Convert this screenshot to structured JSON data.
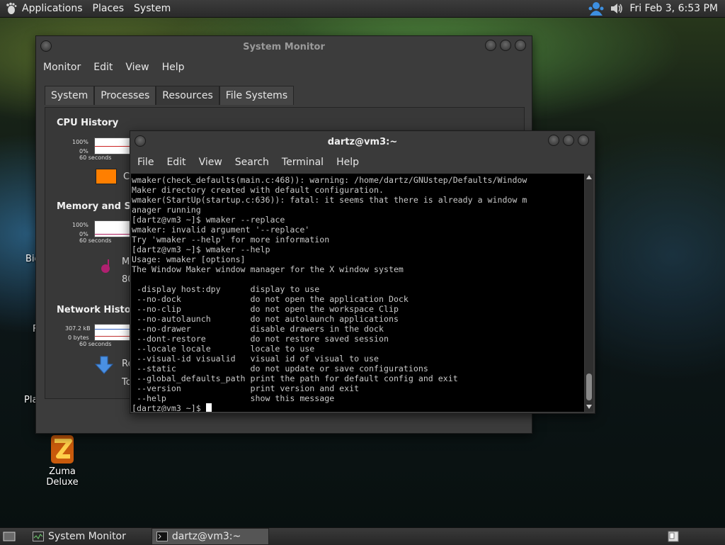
{
  "top_panel": {
    "menus": [
      "Applications",
      "Places",
      "System"
    ],
    "clock": "Fri Feb  3,  6:53 PM",
    "icons": [
      "gnome-foot-icon",
      "user-status-icon",
      "volume-icon"
    ]
  },
  "desktop": {
    "icons": [
      {
        "label": "Zuma Deluxe",
        "icon": "zuma-icon"
      }
    ],
    "clipped_labels": [
      "Big",
      "F",
      "Pla"
    ]
  },
  "system_monitor": {
    "title": "System Monitor",
    "menus": [
      "Monitor",
      "Edit",
      "View",
      "Help"
    ],
    "tabs": [
      "System",
      "Processes",
      "Resources",
      "File Systems"
    ],
    "active_tab": "Resources",
    "sections": {
      "cpu": {
        "title": "CPU History",
        "top": "100%",
        "bottom": "0%",
        "time": "60 seconds",
        "legend_letter": "C",
        "color": "#ff7f00"
      },
      "memory": {
        "title": "Memory and Swa",
        "top": "100%",
        "bottom": "0%",
        "time": "60 seconds",
        "legend_letter": "M",
        "value_fragment": "80"
      },
      "network": {
        "title": "Network History",
        "top": "307.2 kB",
        "bottom": "0 bytes",
        "time": "60 seconds",
        "recv_fragment": "Re",
        "total_fragment": "To"
      }
    }
  },
  "terminal": {
    "title": "dartz@vm3:~",
    "menus": [
      "File",
      "Edit",
      "View",
      "Search",
      "Terminal",
      "Help"
    ],
    "lines": [
      "wmaker(check_defaults(main.c:468)): warning: /home/dartz/GNUstep/Defaults/Window",
      "Maker directory created with default configuration.",
      "wmaker(StartUp(startup.c:636)): fatal: it seems that there is already a window m",
      "anager running",
      "[dartz@vm3 ~]$ wmaker --replace",
      "wmaker: invalid argument '--replace'",
      "Try 'wmaker --help' for more information",
      "[dartz@vm3 ~]$ wmaker --help",
      "Usage: wmaker [options]",
      "The Window Maker window manager for the X window system",
      "",
      " -display host:dpy      display to use",
      " --no-dock              do not open the application Dock",
      " --no-clip              do not open the workspace Clip",
      " --no-autolaunch        do not autolaunch applications",
      " --no-drawer            disable drawers in the dock",
      " --dont-restore         do not restore saved session",
      " --locale locale        locale to use",
      " --visual-id visualid   visual id of visual to use",
      " --static               do not update or save configurations",
      " --global_defaults_path print the path for default config and exit",
      " --version              print version and exit",
      " --help                 show this message"
    ],
    "prompt": "[dartz@vm3 ~]$ "
  },
  "taskbar": {
    "items": [
      {
        "label": "System Monitor",
        "active": false
      },
      {
        "label": "dartz@vm3:~",
        "active": true
      }
    ]
  }
}
